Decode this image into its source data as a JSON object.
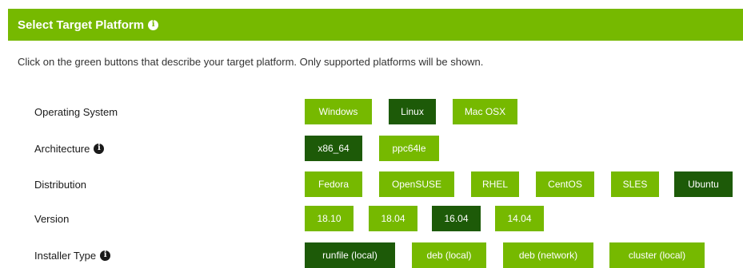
{
  "header": {
    "title": "Select Target Platform"
  },
  "instructions": "Click on the green buttons that describe your target platform. Only supported platforms will be shown.",
  "colors": {
    "accent": "#76b900",
    "selected": "#1d5a08"
  },
  "rows": [
    {
      "label": "Operating System",
      "has_info_icon": false,
      "options": [
        {
          "label": "Windows",
          "selected": false
        },
        {
          "label": "Linux",
          "selected": true
        },
        {
          "label": "Mac OSX",
          "selected": false
        }
      ]
    },
    {
      "label": "Architecture",
      "has_info_icon": true,
      "options": [
        {
          "label": "x86_64",
          "selected": true
        },
        {
          "label": "ppc64le",
          "selected": false
        }
      ]
    },
    {
      "label": "Distribution",
      "has_info_icon": false,
      "options": [
        {
          "label": "Fedora",
          "selected": false
        },
        {
          "label": "OpenSUSE",
          "selected": false
        },
        {
          "label": "RHEL",
          "selected": false
        },
        {
          "label": "CentOS",
          "selected": false
        },
        {
          "label": "SLES",
          "selected": false
        },
        {
          "label": "Ubuntu",
          "selected": true
        }
      ]
    },
    {
      "label": "Version",
      "has_info_icon": false,
      "options": [
        {
          "label": "18.10",
          "selected": false
        },
        {
          "label": "18.04",
          "selected": false
        },
        {
          "label": "16.04",
          "selected": true
        },
        {
          "label": "14.04",
          "selected": false
        }
      ]
    },
    {
      "label": "Installer Type",
      "has_info_icon": true,
      "options": [
        {
          "label": "runfile (local)",
          "selected": true
        },
        {
          "label": "deb (local)",
          "selected": false
        },
        {
          "label": "deb (network)",
          "selected": false
        },
        {
          "label": "cluster (local)",
          "selected": false
        }
      ]
    }
  ]
}
